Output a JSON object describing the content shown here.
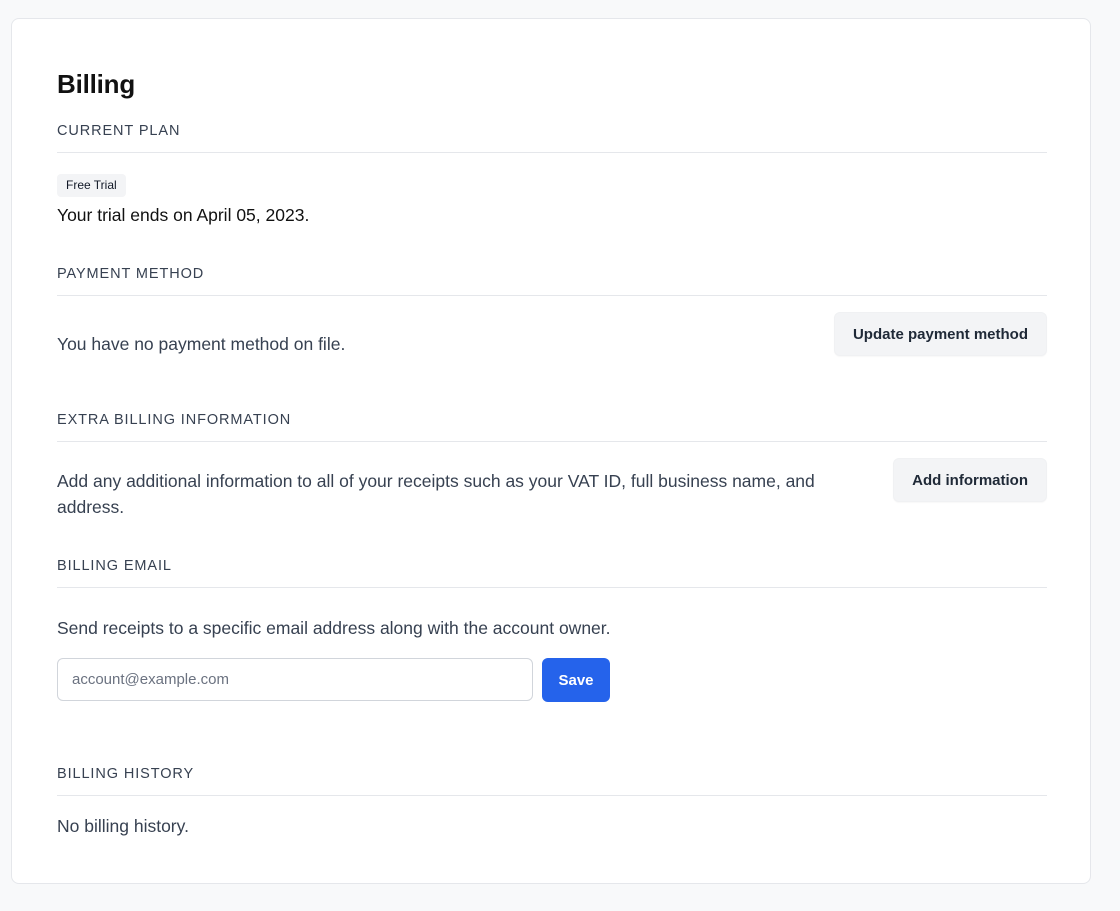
{
  "page": {
    "title": "Billing"
  },
  "current_plan": {
    "heading": "CURRENT PLAN",
    "badge": "Free Trial",
    "text": "Your trial ends on April 05, 2023."
  },
  "payment_method": {
    "heading": "PAYMENT METHOD",
    "text": "You have no payment method on file.",
    "button_label": "Update payment method"
  },
  "extra_billing": {
    "heading": "EXTRA BILLING INFORMATION",
    "text": "Add any additional information to all of your receipts such as your VAT ID, full business name, and address.",
    "button_label": "Add information"
  },
  "billing_email": {
    "heading": "BILLING EMAIL",
    "text": "Send receipts to a specific email address along with the account owner.",
    "input_value": "",
    "input_placeholder": "account@example.com",
    "save_label": "Save"
  },
  "billing_history": {
    "heading": "BILLING HISTORY",
    "text": "No billing history."
  },
  "colors": {
    "primary": "#2563eb",
    "secondary_button_bg": "#f3f4f6",
    "background": "#f8f9fa",
    "card": "#ffffff",
    "divider": "#e5e7eb"
  }
}
